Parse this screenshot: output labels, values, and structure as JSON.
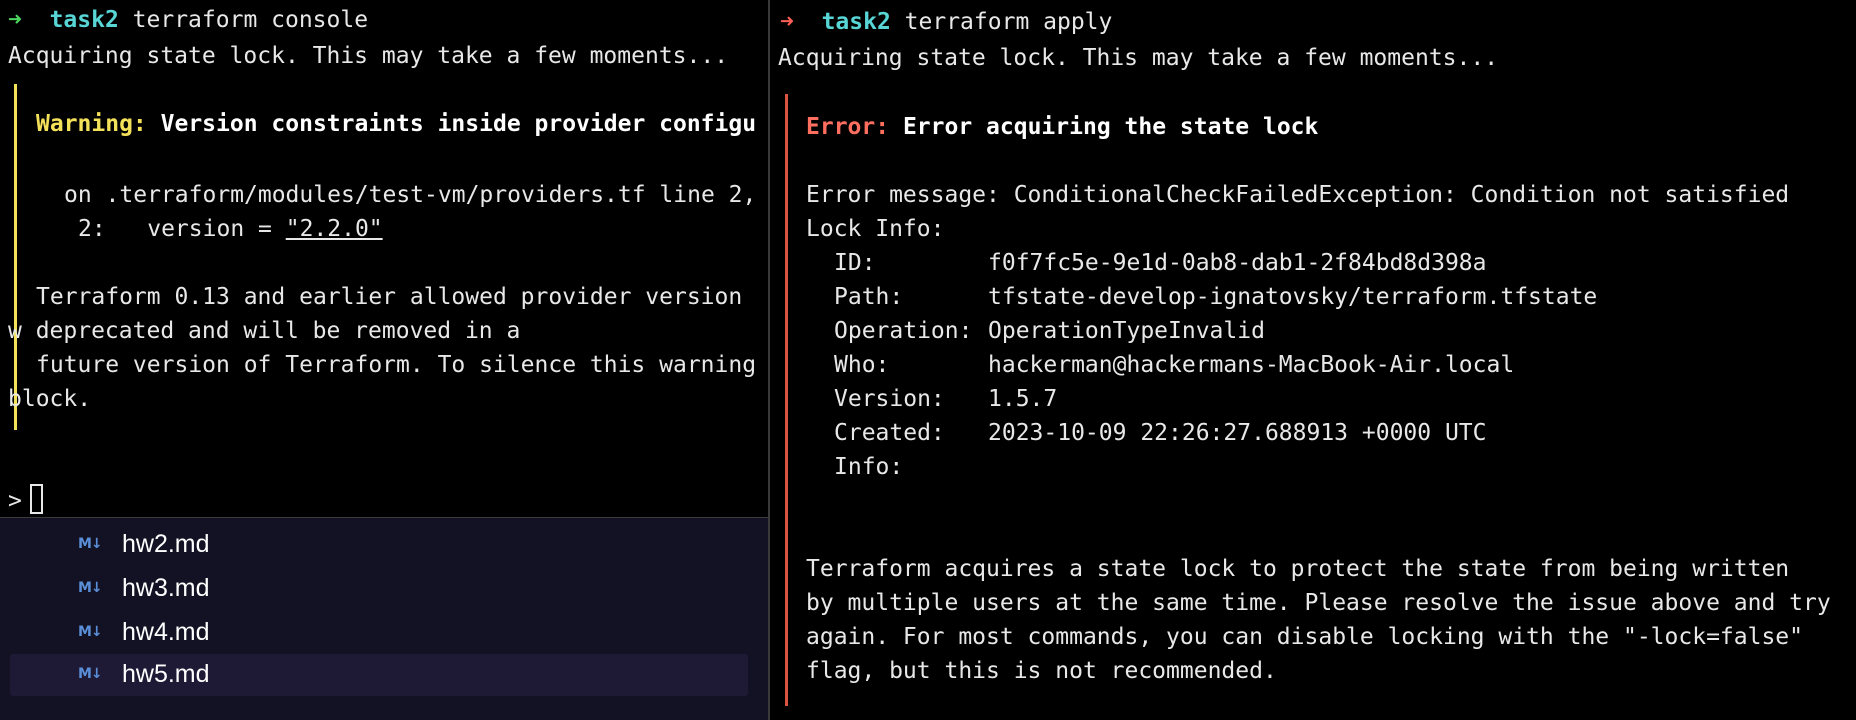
{
  "left_terminal": {
    "prompt_symbol": "➜",
    "cwd": "task2",
    "command": "terraform console",
    "lock_msg": "Acquiring state lock. This may take a few moments...",
    "warning_label": "Warning:",
    "warning_title": "Version constraints inside provider configu",
    "on_line": "on .terraform/modules/test-vm/providers.tf line 2,",
    "code_prefix": "2:   version = ",
    "code_value": "\"2.2.0\"",
    "body_1": "Terraform 0.13 and earlier allowed provider version ",
    "body_2": "w deprecated and will be removed in a",
    "body_3": "future version of Terraform. To silence this warning",
    "body_4": "block.",
    "repl_prompt": ">"
  },
  "right_terminal": {
    "prompt_symbol": "➜",
    "cwd": "task2",
    "command": "terraform apply",
    "lock_msg": "Acquiring state lock. This may take a few moments...",
    "error_label": "Error:",
    "error_title": "Error acquiring the state lock",
    "error_message": "Error message: ConditionalCheckFailedException: Condition not satisfied",
    "lock_info_label": "Lock Info:",
    "lock_info": {
      "id_key": "ID:",
      "id_val": "f0f7fc5e-9e1d-0ab8-dab1-2f84bd8d398a",
      "path_key": "Path:",
      "path_val": "tfstate-develop-ignatovsky/terraform.tfstate",
      "op_key": "Operation:",
      "op_val": "OperationTypeInvalid",
      "who_key": "Who:",
      "who_val": "hackerman@hackermans-MacBook-Air.local",
      "version_key": "Version:",
      "version_val": "1.5.7",
      "created_key": "Created:",
      "created_val": "2023-10-09 22:26:27.688913 +0000 UTC",
      "info_key": "Info:"
    },
    "explain_1": "Terraform acquires a state lock to protect the state from being written",
    "explain_2": "by multiple users at the same time. Please resolve the issue above and try",
    "explain_3": "again. For most commands, you can disable locking with the \"-lock=false\"",
    "explain_4": "flag, but this is not recommended."
  },
  "explorer": {
    "icon_label": "M↓",
    "files": [
      "hw2.md",
      "hw3.md",
      "hw4.md",
      "hw5.md"
    ],
    "selected": "hw5.md"
  },
  "colors": {
    "prompt_ok": "#4bd65e",
    "prompt_err": "#ff5f57",
    "cwd": "#58d6d6",
    "warning": "#f4e15a",
    "error": "#ff6f5f"
  }
}
